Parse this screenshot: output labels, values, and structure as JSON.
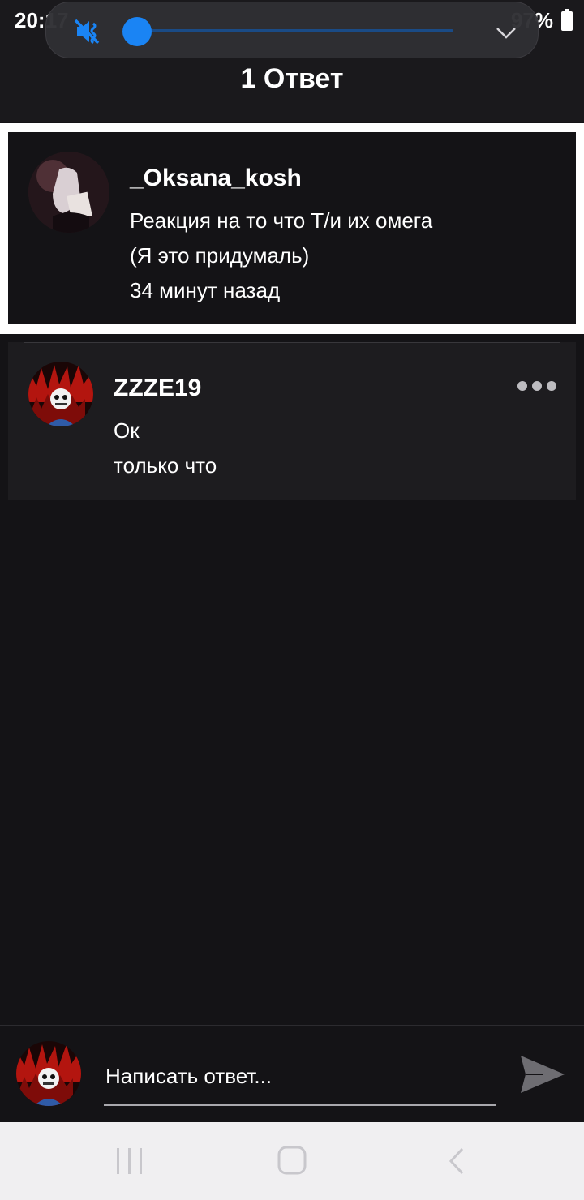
{
  "status_bar": {
    "time": "20:17",
    "battery": "97%"
  },
  "volume_panel": {
    "mute_icon": "vibrate-mute-icon",
    "level": 0.0,
    "expand_icon": "chevron-down-icon",
    "accent": "#1a84f4"
  },
  "header": {
    "title": "1 Ответ"
  },
  "original_post": {
    "author": "_Oksana_kosh",
    "line1": "Реакция на то что Т/и их омега",
    "line2": "(Я это придумаль)",
    "time": "34 минут назад"
  },
  "reply": {
    "author": "ZZZE19",
    "text": "Ок",
    "time": "только что",
    "more_icon": "more-dots-icon"
  },
  "composer": {
    "placeholder": "Написать ответ...",
    "send_icon": "send-icon"
  },
  "nav_bar": {
    "recents_icon": "recents-icon",
    "home_icon": "home-icon",
    "back_icon": "back-icon"
  }
}
